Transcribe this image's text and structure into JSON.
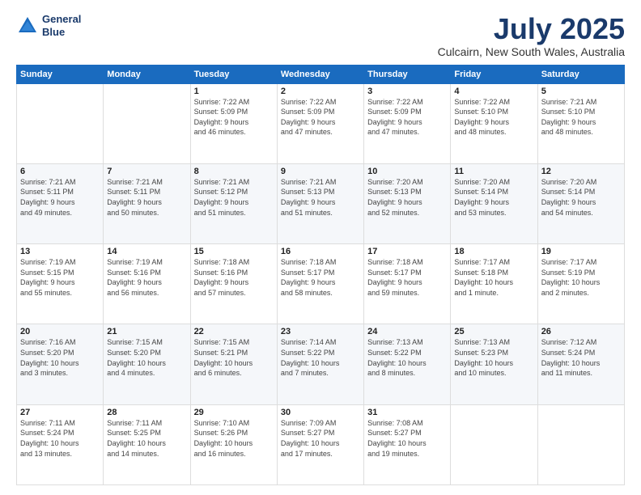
{
  "header": {
    "logo_line1": "General",
    "logo_line2": "Blue",
    "title": "July 2025",
    "subtitle": "Culcairn, New South Wales, Australia"
  },
  "days_of_week": [
    "Sunday",
    "Monday",
    "Tuesday",
    "Wednesday",
    "Thursday",
    "Friday",
    "Saturday"
  ],
  "weeks": [
    [
      {
        "day": "",
        "info": ""
      },
      {
        "day": "",
        "info": ""
      },
      {
        "day": "1",
        "info": "Sunrise: 7:22 AM\nSunset: 5:09 PM\nDaylight: 9 hours\nand 46 minutes."
      },
      {
        "day": "2",
        "info": "Sunrise: 7:22 AM\nSunset: 5:09 PM\nDaylight: 9 hours\nand 47 minutes."
      },
      {
        "day": "3",
        "info": "Sunrise: 7:22 AM\nSunset: 5:09 PM\nDaylight: 9 hours\nand 47 minutes."
      },
      {
        "day": "4",
        "info": "Sunrise: 7:22 AM\nSunset: 5:10 PM\nDaylight: 9 hours\nand 48 minutes."
      },
      {
        "day": "5",
        "info": "Sunrise: 7:21 AM\nSunset: 5:10 PM\nDaylight: 9 hours\nand 48 minutes."
      }
    ],
    [
      {
        "day": "6",
        "info": "Sunrise: 7:21 AM\nSunset: 5:11 PM\nDaylight: 9 hours\nand 49 minutes."
      },
      {
        "day": "7",
        "info": "Sunrise: 7:21 AM\nSunset: 5:11 PM\nDaylight: 9 hours\nand 50 minutes."
      },
      {
        "day": "8",
        "info": "Sunrise: 7:21 AM\nSunset: 5:12 PM\nDaylight: 9 hours\nand 51 minutes."
      },
      {
        "day": "9",
        "info": "Sunrise: 7:21 AM\nSunset: 5:13 PM\nDaylight: 9 hours\nand 51 minutes."
      },
      {
        "day": "10",
        "info": "Sunrise: 7:20 AM\nSunset: 5:13 PM\nDaylight: 9 hours\nand 52 minutes."
      },
      {
        "day": "11",
        "info": "Sunrise: 7:20 AM\nSunset: 5:14 PM\nDaylight: 9 hours\nand 53 minutes."
      },
      {
        "day": "12",
        "info": "Sunrise: 7:20 AM\nSunset: 5:14 PM\nDaylight: 9 hours\nand 54 minutes."
      }
    ],
    [
      {
        "day": "13",
        "info": "Sunrise: 7:19 AM\nSunset: 5:15 PM\nDaylight: 9 hours\nand 55 minutes."
      },
      {
        "day": "14",
        "info": "Sunrise: 7:19 AM\nSunset: 5:16 PM\nDaylight: 9 hours\nand 56 minutes."
      },
      {
        "day": "15",
        "info": "Sunrise: 7:18 AM\nSunset: 5:16 PM\nDaylight: 9 hours\nand 57 minutes."
      },
      {
        "day": "16",
        "info": "Sunrise: 7:18 AM\nSunset: 5:17 PM\nDaylight: 9 hours\nand 58 minutes."
      },
      {
        "day": "17",
        "info": "Sunrise: 7:18 AM\nSunset: 5:17 PM\nDaylight: 9 hours\nand 59 minutes."
      },
      {
        "day": "18",
        "info": "Sunrise: 7:17 AM\nSunset: 5:18 PM\nDaylight: 10 hours\nand 1 minute."
      },
      {
        "day": "19",
        "info": "Sunrise: 7:17 AM\nSunset: 5:19 PM\nDaylight: 10 hours\nand 2 minutes."
      }
    ],
    [
      {
        "day": "20",
        "info": "Sunrise: 7:16 AM\nSunset: 5:20 PM\nDaylight: 10 hours\nand 3 minutes."
      },
      {
        "day": "21",
        "info": "Sunrise: 7:15 AM\nSunset: 5:20 PM\nDaylight: 10 hours\nand 4 minutes."
      },
      {
        "day": "22",
        "info": "Sunrise: 7:15 AM\nSunset: 5:21 PM\nDaylight: 10 hours\nand 6 minutes."
      },
      {
        "day": "23",
        "info": "Sunrise: 7:14 AM\nSunset: 5:22 PM\nDaylight: 10 hours\nand 7 minutes."
      },
      {
        "day": "24",
        "info": "Sunrise: 7:13 AM\nSunset: 5:22 PM\nDaylight: 10 hours\nand 8 minutes."
      },
      {
        "day": "25",
        "info": "Sunrise: 7:13 AM\nSunset: 5:23 PM\nDaylight: 10 hours\nand 10 minutes."
      },
      {
        "day": "26",
        "info": "Sunrise: 7:12 AM\nSunset: 5:24 PM\nDaylight: 10 hours\nand 11 minutes."
      }
    ],
    [
      {
        "day": "27",
        "info": "Sunrise: 7:11 AM\nSunset: 5:24 PM\nDaylight: 10 hours\nand 13 minutes."
      },
      {
        "day": "28",
        "info": "Sunrise: 7:11 AM\nSunset: 5:25 PM\nDaylight: 10 hours\nand 14 minutes."
      },
      {
        "day": "29",
        "info": "Sunrise: 7:10 AM\nSunset: 5:26 PM\nDaylight: 10 hours\nand 16 minutes."
      },
      {
        "day": "30",
        "info": "Sunrise: 7:09 AM\nSunset: 5:27 PM\nDaylight: 10 hours\nand 17 minutes."
      },
      {
        "day": "31",
        "info": "Sunrise: 7:08 AM\nSunset: 5:27 PM\nDaylight: 10 hours\nand 19 minutes."
      },
      {
        "day": "",
        "info": ""
      },
      {
        "day": "",
        "info": ""
      }
    ]
  ]
}
